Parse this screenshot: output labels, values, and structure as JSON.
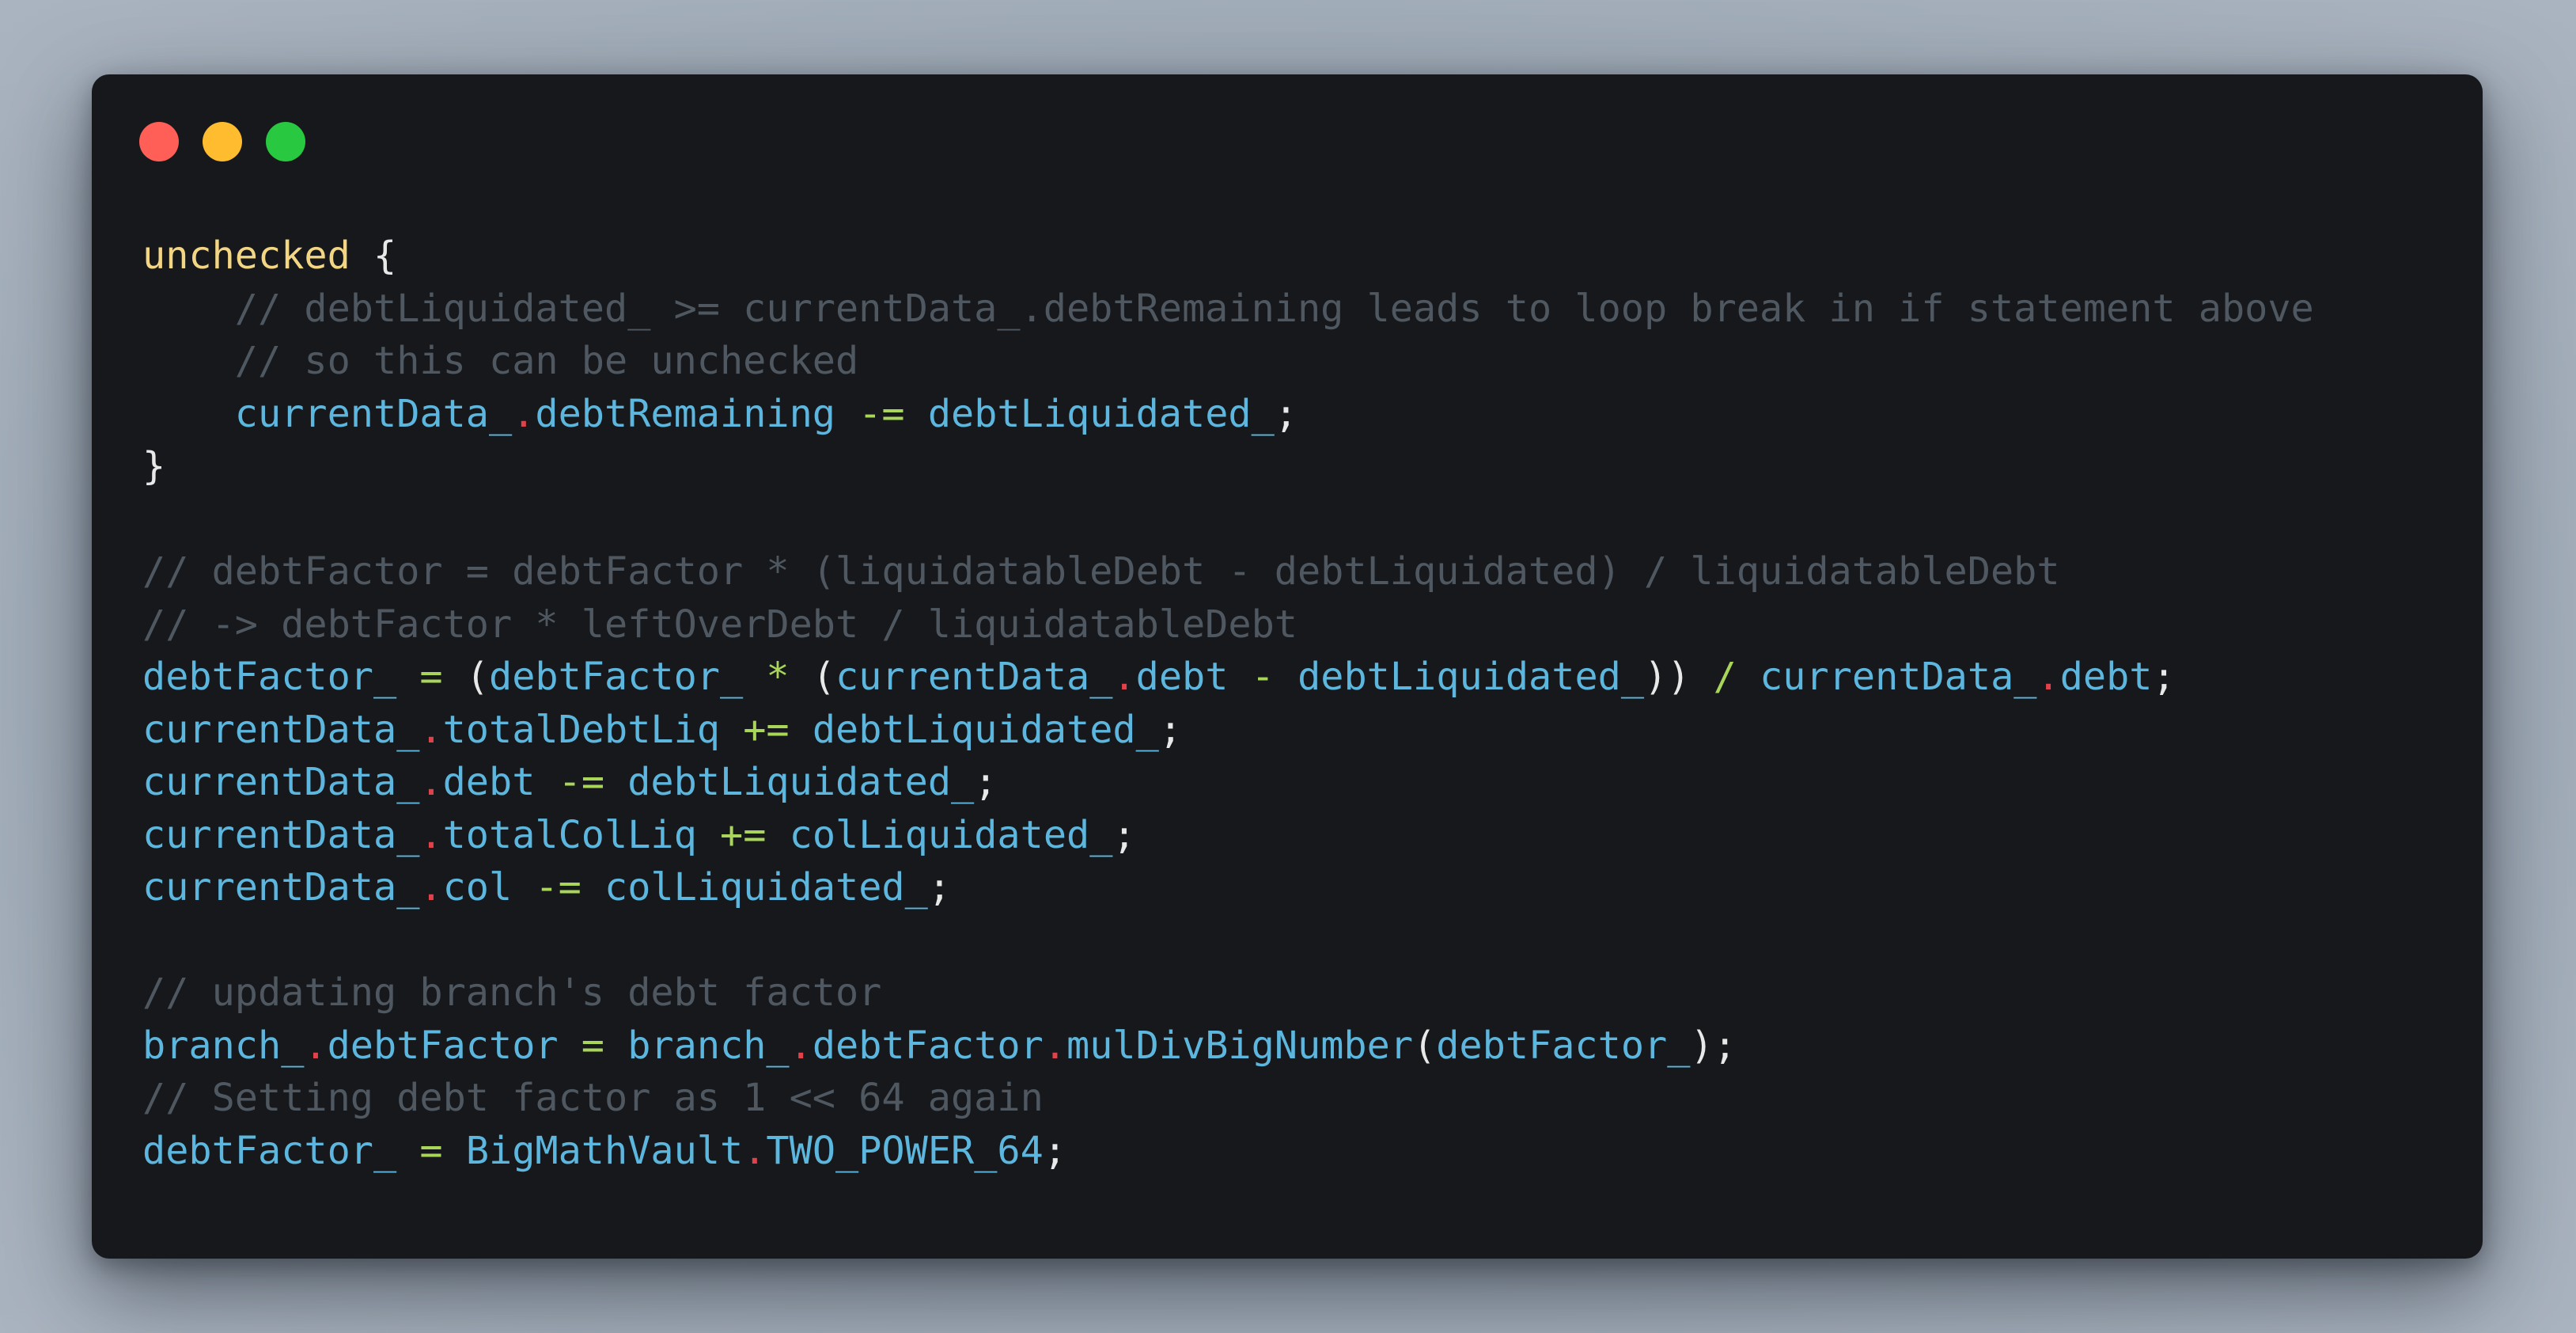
{
  "window": {
    "controls": [
      {
        "name": "close",
        "color": "#ff5f57"
      },
      {
        "name": "minimize",
        "color": "#febc2e"
      },
      {
        "name": "maximize",
        "color": "#28c840"
      }
    ]
  },
  "code": {
    "lines": [
      [
        {
          "t": "kw",
          "v": "unchecked"
        },
        {
          "t": "pn",
          "v": " {"
        }
      ],
      [
        {
          "t": "cm",
          "v": "    // debtLiquidated_ >= currentData_.debtRemaining leads to loop break in if statement above"
        }
      ],
      [
        {
          "t": "cm",
          "v": "    // so this can be unchecked"
        }
      ],
      [
        {
          "t": "id",
          "v": "    currentData_"
        },
        {
          "t": "dt",
          "v": "."
        },
        {
          "t": "id",
          "v": "debtRemaining"
        },
        {
          "t": "op",
          "v": " -= "
        },
        {
          "t": "id",
          "v": "debtLiquidated_"
        },
        {
          "t": "pn",
          "v": ";"
        }
      ],
      [
        {
          "t": "pn",
          "v": "}"
        }
      ],
      [],
      [
        {
          "t": "cm",
          "v": "// debtFactor = debtFactor * (liquidatableDebt - debtLiquidated) / liquidatableDebt"
        }
      ],
      [
        {
          "t": "cm",
          "v": "// -> debtFactor * leftOverDebt / liquidatableDebt"
        }
      ],
      [
        {
          "t": "id",
          "v": "debtFactor_"
        },
        {
          "t": "op",
          "v": " = "
        },
        {
          "t": "pn",
          "v": "("
        },
        {
          "t": "id",
          "v": "debtFactor_"
        },
        {
          "t": "op",
          "v": " * "
        },
        {
          "t": "pn",
          "v": "("
        },
        {
          "t": "id",
          "v": "currentData_"
        },
        {
          "t": "dt",
          "v": "."
        },
        {
          "t": "id",
          "v": "debt"
        },
        {
          "t": "op",
          "v": " - "
        },
        {
          "t": "id",
          "v": "debtLiquidated_"
        },
        {
          "t": "pn",
          "v": "))"
        },
        {
          "t": "op",
          "v": " / "
        },
        {
          "t": "id",
          "v": "currentData_"
        },
        {
          "t": "dt",
          "v": "."
        },
        {
          "t": "id",
          "v": "debt"
        },
        {
          "t": "pn",
          "v": ";"
        }
      ],
      [
        {
          "t": "id",
          "v": "currentData_"
        },
        {
          "t": "dt",
          "v": "."
        },
        {
          "t": "id",
          "v": "totalDebtLiq"
        },
        {
          "t": "op",
          "v": " += "
        },
        {
          "t": "id",
          "v": "debtLiquidated_"
        },
        {
          "t": "pn",
          "v": ";"
        }
      ],
      [
        {
          "t": "id",
          "v": "currentData_"
        },
        {
          "t": "dt",
          "v": "."
        },
        {
          "t": "id",
          "v": "debt"
        },
        {
          "t": "op",
          "v": " -= "
        },
        {
          "t": "id",
          "v": "debtLiquidated_"
        },
        {
          "t": "pn",
          "v": ";"
        }
      ],
      [
        {
          "t": "id",
          "v": "currentData_"
        },
        {
          "t": "dt",
          "v": "."
        },
        {
          "t": "id",
          "v": "totalColLiq"
        },
        {
          "t": "op",
          "v": " += "
        },
        {
          "t": "id",
          "v": "colLiquidated_"
        },
        {
          "t": "pn",
          "v": ";"
        }
      ],
      [
        {
          "t": "id",
          "v": "currentData_"
        },
        {
          "t": "dt",
          "v": "."
        },
        {
          "t": "id",
          "v": "col"
        },
        {
          "t": "op",
          "v": " -= "
        },
        {
          "t": "id",
          "v": "colLiquidated_"
        },
        {
          "t": "pn",
          "v": ";"
        }
      ],
      [],
      [
        {
          "t": "cm",
          "v": "// updating branch's debt factor"
        }
      ],
      [
        {
          "t": "id",
          "v": "branch_"
        },
        {
          "t": "dt",
          "v": "."
        },
        {
          "t": "id",
          "v": "debtFactor"
        },
        {
          "t": "op",
          "v": " = "
        },
        {
          "t": "id",
          "v": "branch_"
        },
        {
          "t": "dt",
          "v": "."
        },
        {
          "t": "id",
          "v": "debtFactor"
        },
        {
          "t": "dt",
          "v": "."
        },
        {
          "t": "id",
          "v": "mulDivBigNumber"
        },
        {
          "t": "pn",
          "v": "("
        },
        {
          "t": "id",
          "v": "debtFactor_"
        },
        {
          "t": "pn",
          "v": ");"
        }
      ],
      [
        {
          "t": "cm",
          "v": "// Setting debt factor as 1 << 64 again"
        }
      ],
      [
        {
          "t": "id",
          "v": "debtFactor_"
        },
        {
          "t": "op",
          "v": " = "
        },
        {
          "t": "id",
          "v": "BigMathVault"
        },
        {
          "t": "dt",
          "v": "."
        },
        {
          "t": "id",
          "v": "TWO_POWER_64"
        },
        {
          "t": "pn",
          "v": ";"
        }
      ]
    ]
  }
}
